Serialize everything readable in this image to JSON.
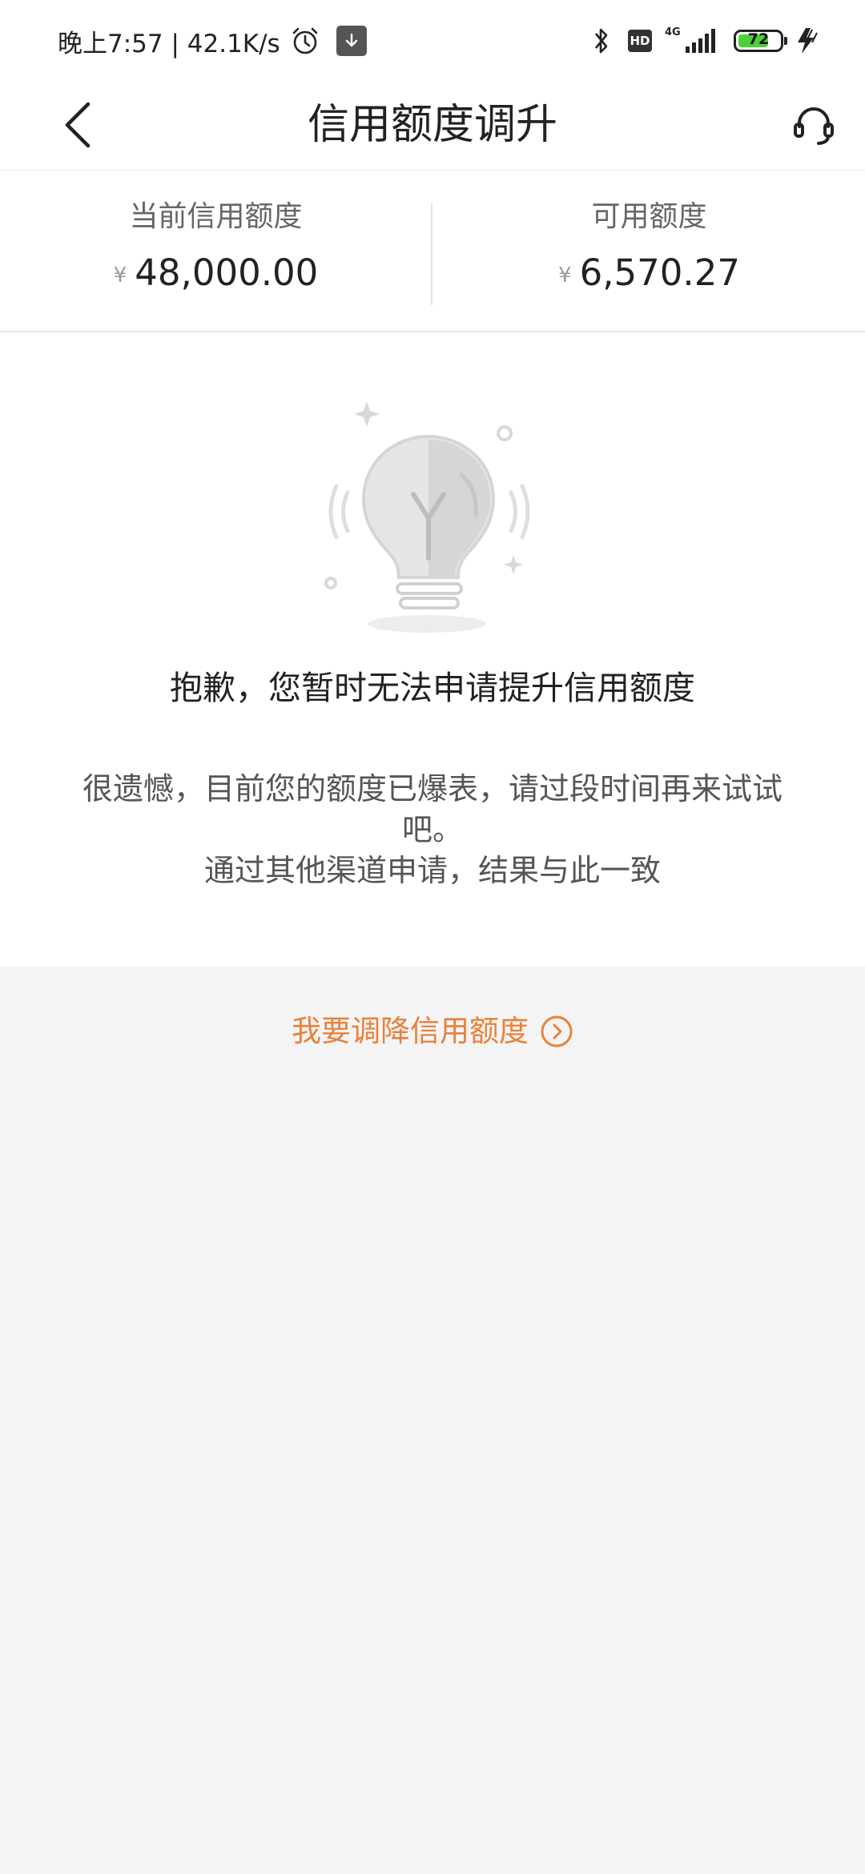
{
  "status_bar": {
    "time_speed": "晚上7:57 | 42.1K/s",
    "hd_label": "HD",
    "network_label": "4G",
    "battery_level": "72",
    "icons": [
      "alarm-icon",
      "download-icon",
      "bluetooth-icon",
      "signal-icon",
      "battery-icon",
      "charging-icon"
    ]
  },
  "header": {
    "title": "信用额度调升",
    "back_icon": "chevron-left-icon",
    "support_icon": "headset-icon"
  },
  "credit_summary": {
    "current_limit_label": "当前信用额度",
    "current_limit_currency": "¥",
    "current_limit_value": "48,000.00",
    "available_limit_label": "可用额度",
    "available_limit_currency": "¥",
    "available_limit_value": "6,570.27"
  },
  "message": {
    "illustration": "lightbulb-icon",
    "title": "抱歉，您暂时无法申请提升信用额度",
    "body_line1": "很遗憾，目前您的额度已爆表，请过段时间再来试试吧。",
    "body_line2": "通过其他渠道申请，结果与此一致"
  },
  "reduce_link": {
    "label": "我要调降信用额度",
    "icon": "arrow-right-circle-icon"
  },
  "colors": {
    "accent": "#e9813a",
    "background": "#f4f4f4",
    "card": "#ffffff",
    "battery_fill": "#4cd137"
  }
}
